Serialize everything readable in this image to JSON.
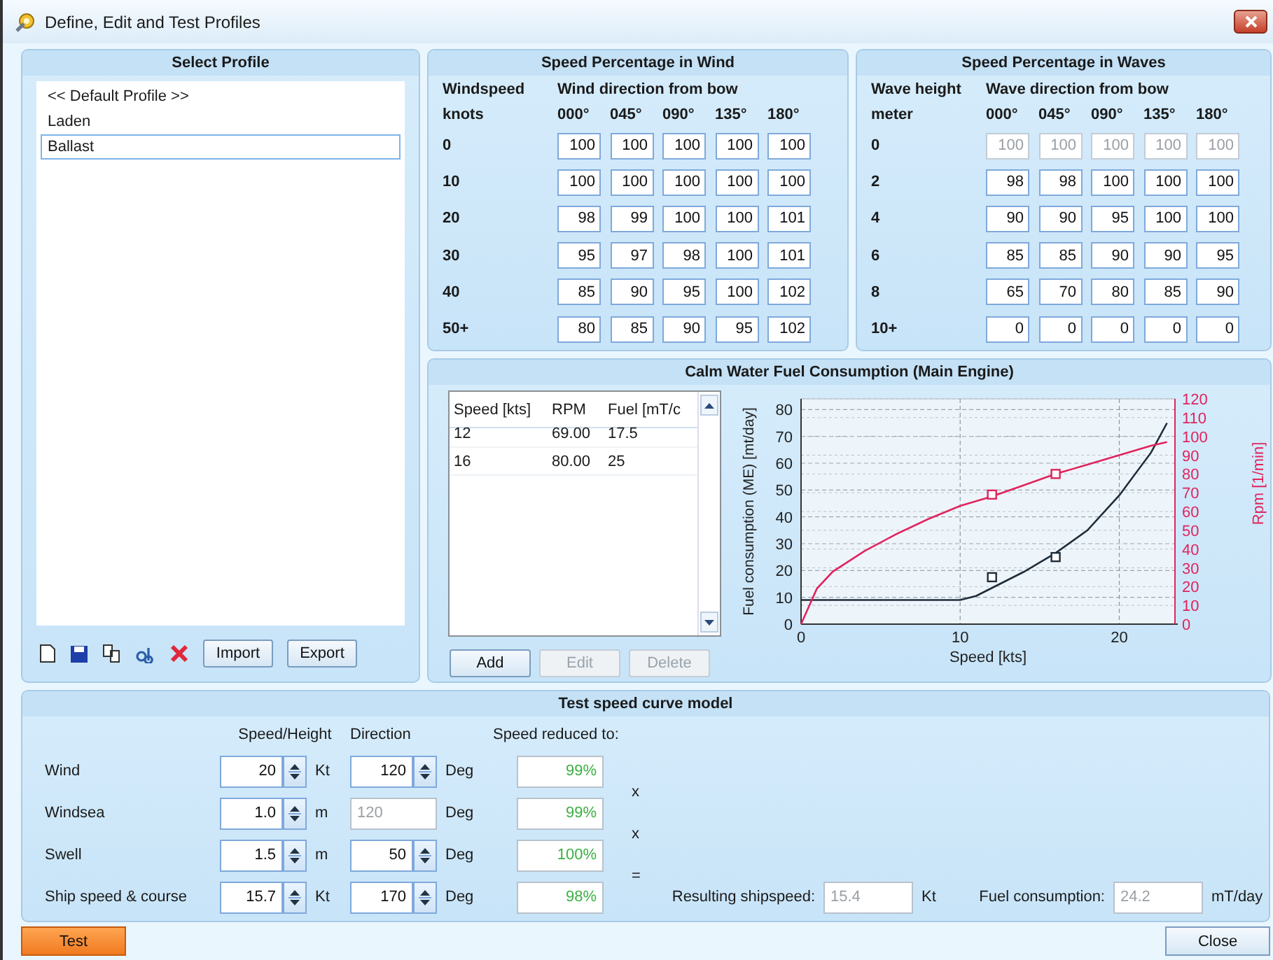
{
  "window": {
    "title": "Define, Edit and Test Profiles"
  },
  "select_profile": {
    "title": "Select Profile",
    "items": [
      {
        "label": "<< Default Profile >>",
        "selected": false
      },
      {
        "label": "Laden",
        "selected": false
      },
      {
        "label": "Ballast",
        "selected": true
      }
    ],
    "buttons": [
      "Import",
      "Export"
    ]
  },
  "wind": {
    "title": "Speed Percentage in Wind",
    "row_header": [
      "Windspeed",
      "knots"
    ],
    "col_header": "Wind direction from bow",
    "directions": [
      "000°",
      "045°",
      "090°",
      "135°",
      "180°"
    ],
    "rows": [
      {
        "label": "0",
        "values": [
          "100",
          "100",
          "100",
          "100",
          "100"
        ],
        "disabled": false
      },
      {
        "label": "10",
        "values": [
          "100",
          "100",
          "100",
          "100",
          "100"
        ],
        "disabled": false
      },
      {
        "label": "20",
        "values": [
          "98",
          "99",
          "100",
          "100",
          "101"
        ],
        "disabled": false
      },
      {
        "label": "30",
        "values": [
          "95",
          "97",
          "98",
          "100",
          "101"
        ],
        "disabled": false
      },
      {
        "label": "40",
        "values": [
          "85",
          "90",
          "95",
          "100",
          "102"
        ],
        "disabled": false
      },
      {
        "label": "50+",
        "values": [
          "80",
          "85",
          "90",
          "95",
          "102"
        ],
        "disabled": false
      }
    ]
  },
  "waves": {
    "title": "Speed Percentage in Waves",
    "row_header": [
      "Wave height",
      "meter"
    ],
    "col_header": "Wave direction from bow",
    "directions": [
      "000°",
      "045°",
      "090°",
      "135°",
      "180°"
    ],
    "rows": [
      {
        "label": "0",
        "values": [
          "100",
          "100",
          "100",
          "100",
          "100"
        ],
        "disabled": true
      },
      {
        "label": "2",
        "values": [
          "98",
          "98",
          "100",
          "100",
          "100"
        ],
        "disabled": false
      },
      {
        "label": "4",
        "values": [
          "90",
          "90",
          "95",
          "100",
          "100"
        ],
        "disabled": false
      },
      {
        "label": "6",
        "values": [
          "85",
          "85",
          "90",
          "90",
          "95"
        ],
        "disabled": false
      },
      {
        "label": "8",
        "values": [
          "65",
          "70",
          "80",
          "85",
          "90"
        ],
        "disabled": false
      },
      {
        "label": "10+",
        "values": [
          "0",
          "0",
          "0",
          "0",
          "0"
        ],
        "disabled": false
      }
    ]
  },
  "fuel": {
    "title": "Calm Water Fuel Consumption (Main Engine)",
    "columns": [
      "Speed [kts]",
      "RPM",
      "Fuel [mT/c"
    ],
    "rows": [
      [
        "12",
        "69.00",
        "17.5"
      ],
      [
        "16",
        "80.00",
        "25"
      ]
    ],
    "buttons": [
      {
        "label": "Add",
        "disabled": false
      },
      {
        "label": "Edit",
        "disabled": true
      },
      {
        "label": "Delete",
        "disabled": true
      }
    ],
    "chart_data": {
      "type": "line",
      "grid": true,
      "xlabel": "Speed [kts]",
      "ylabel": "Fuel consumption (ME) [mt/day]",
      "y2label": "Rpm [1/min]",
      "x": [
        0,
        1,
        2,
        4,
        6,
        8,
        10,
        11,
        12,
        14,
        16,
        18,
        20,
        22,
        23
      ],
      "xlim": [
        0,
        23.5
      ],
      "ylim": [
        0,
        84
      ],
      "y2lim": [
        0,
        120
      ],
      "xticks": [
        0,
        10,
        20
      ],
      "yticks": [
        {
          "value": 0,
          "label": "0"
        },
        {
          "value": 10,
          "label": "10"
        },
        {
          "value": 20,
          "label": "20"
        },
        {
          "value": 30,
          "label": "30"
        },
        {
          "value": 40,
          "label": "40"
        },
        {
          "value": 50,
          "label": "50"
        },
        {
          "value": 60,
          "label": "60"
        },
        {
          "value": 70,
          "label": "70"
        },
        {
          "value": 80,
          "label": "80"
        }
      ],
      "y2ticks": [
        {
          "value": 0,
          "label": "0"
        },
        {
          "value": 10,
          "label": "10"
        },
        {
          "value": 20,
          "label": "20"
        },
        {
          "value": 30,
          "label": "30"
        },
        {
          "value": 40,
          "label": "40"
        },
        {
          "value": 50,
          "label": "50"
        },
        {
          "value": 60,
          "label": "60"
        },
        {
          "value": 70,
          "label": "70"
        },
        {
          "value": 80,
          "label": "80"
        },
        {
          "value": 90,
          "label": "90"
        },
        {
          "value": 100,
          "label": "100"
        },
        {
          "value": 110,
          "label": "110"
        },
        {
          "value": 120,
          "label": "120"
        }
      ],
      "series": [
        {
          "color": "#1f2d3a",
          "values": [
            9,
            9,
            9,
            9,
            9,
            9,
            9,
            10.5,
            13.5,
            19.5,
            26.5,
            35,
            48,
            64,
            75
          ]
        },
        {
          "color": "#e0245e",
          "axis": "y2",
          "values": [
            0,
            19,
            28,
            39,
            48,
            56,
            63,
            65.5,
            68,
            74,
            80,
            85,
            90,
            95,
            97
          ]
        },
        {
          "color": "#1f2d3a",
          "type": "scatter",
          "values": [
            null,
            null,
            null,
            null,
            null,
            null,
            null,
            null,
            17.5,
            null,
            25,
            null,
            null,
            null,
            null
          ]
        },
        {
          "color": "#e0245e",
          "type": "scatter",
          "axis": "y2",
          "values": [
            null,
            null,
            null,
            null,
            null,
            null,
            null,
            null,
            69,
            null,
            80,
            null,
            null,
            null,
            null
          ]
        }
      ]
    }
  },
  "test": {
    "title": "Test speed curve model",
    "headers": [
      "Speed/Height",
      "Direction",
      "Speed reduced to:"
    ],
    "rows": [
      {
        "label": "Wind",
        "speed": "20",
        "speed_unit": "Kt",
        "direction": "120",
        "direction_disabled": false,
        "direction_unit": "Deg",
        "reduced": "99%",
        "operator": "x"
      },
      {
        "label": "Windsea",
        "speed": "1.0",
        "speed_unit": "m",
        "direction": "120",
        "direction_disabled": true,
        "direction_unit": "Deg",
        "reduced": "99%",
        "operator": "x"
      },
      {
        "label": "Swell",
        "speed": "1.5",
        "speed_unit": "m",
        "direction": "50",
        "direction_disabled": false,
        "direction_unit": "Deg",
        "reduced": "100%",
        "operator": "="
      },
      {
        "label": "Ship speed & course",
        "speed": "15.7",
        "speed_unit": "Kt",
        "direction": "170",
        "direction_disabled": false,
        "direction_unit": "Deg",
        "reduced": "98%"
      }
    ],
    "result": {
      "label": "Resulting shipspeed:",
      "value": "15.4",
      "unit": "Kt"
    },
    "consumption": {
      "label": "Fuel consumption:",
      "value": "24.2",
      "unit": "mT/day"
    }
  },
  "footer": {
    "buttons": [
      {
        "label": "Test",
        "kind": "primary"
      },
      {
        "label": "Close",
        "kind": "normal"
      }
    ]
  }
}
